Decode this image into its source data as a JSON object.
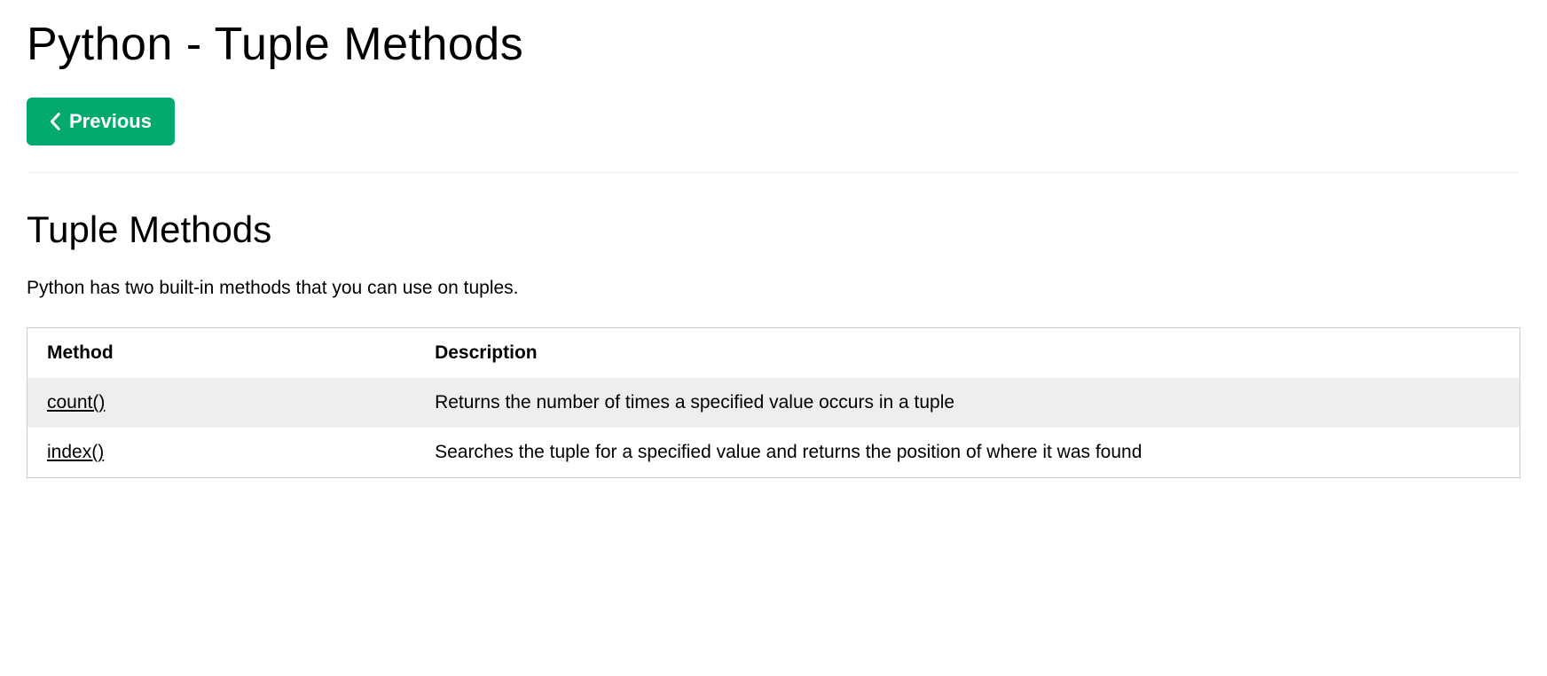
{
  "page_title": "Python - Tuple Methods",
  "nav": {
    "previous_label": "Previous"
  },
  "section_heading": "Tuple Methods",
  "intro_text": "Python has two built-in methods that you can use on tuples.",
  "table": {
    "headers": {
      "method": "Method",
      "description": "Description"
    },
    "rows": [
      {
        "method": "count()",
        "description": "Returns the number of times a specified value occurs in a tuple"
      },
      {
        "method": "index()",
        "description": "Searches the tuple for a specified value and returns the position of where it was found"
      }
    ]
  }
}
